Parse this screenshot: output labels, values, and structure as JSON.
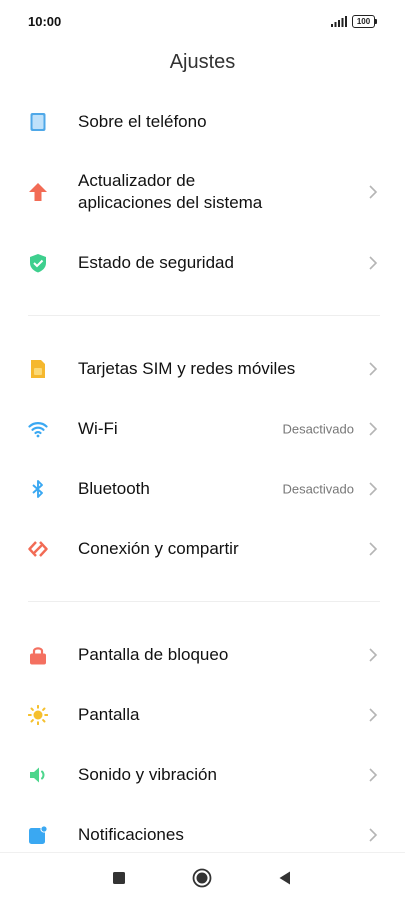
{
  "status_bar": {
    "time": "10:00",
    "battery": "100"
  },
  "header": {
    "title": "Ajustes"
  },
  "sections": [
    {
      "items": [
        {
          "icon": "phone-info-icon",
          "label": "Sobre el teléfono"
        },
        {
          "icon": "update-arrow-icon",
          "label": "Actualizador de\naplicaciones del sistema"
        },
        {
          "icon": "shield-check-icon",
          "label": "Estado de seguridad"
        }
      ]
    },
    {
      "items": [
        {
          "icon": "sim-card-icon",
          "label": "Tarjetas SIM y redes móviles"
        },
        {
          "icon": "wifi-icon",
          "label": "Wi-Fi",
          "value": "Desactivado"
        },
        {
          "icon": "bluetooth-icon",
          "label": "Bluetooth",
          "value": "Desactivado"
        },
        {
          "icon": "share-icon",
          "label": "Conexión y compartir"
        }
      ]
    },
    {
      "items": [
        {
          "icon": "lock-icon",
          "label": "Pantalla de bloqueo"
        },
        {
          "icon": "sun-icon",
          "label": "Pantalla"
        },
        {
          "icon": "speaker-icon",
          "label": "Sonido y vibración"
        },
        {
          "icon": "notification-icon",
          "label": "Notificaciones"
        }
      ]
    }
  ],
  "colors": {
    "phone": "#4fa8e8",
    "update": "#f26b55",
    "shield": "#3ecf8e",
    "sim": "#f5b82e",
    "wifi": "#3aa8f2",
    "bluetooth": "#3aa8f2",
    "share": "#f26b55",
    "lock": "#f47060",
    "sun": "#f5c02e",
    "sound": "#4dd68c",
    "notification": "#3aa8f2"
  },
  "navbar": {
    "buttons": [
      "recents-button",
      "home-button",
      "back-button"
    ]
  }
}
